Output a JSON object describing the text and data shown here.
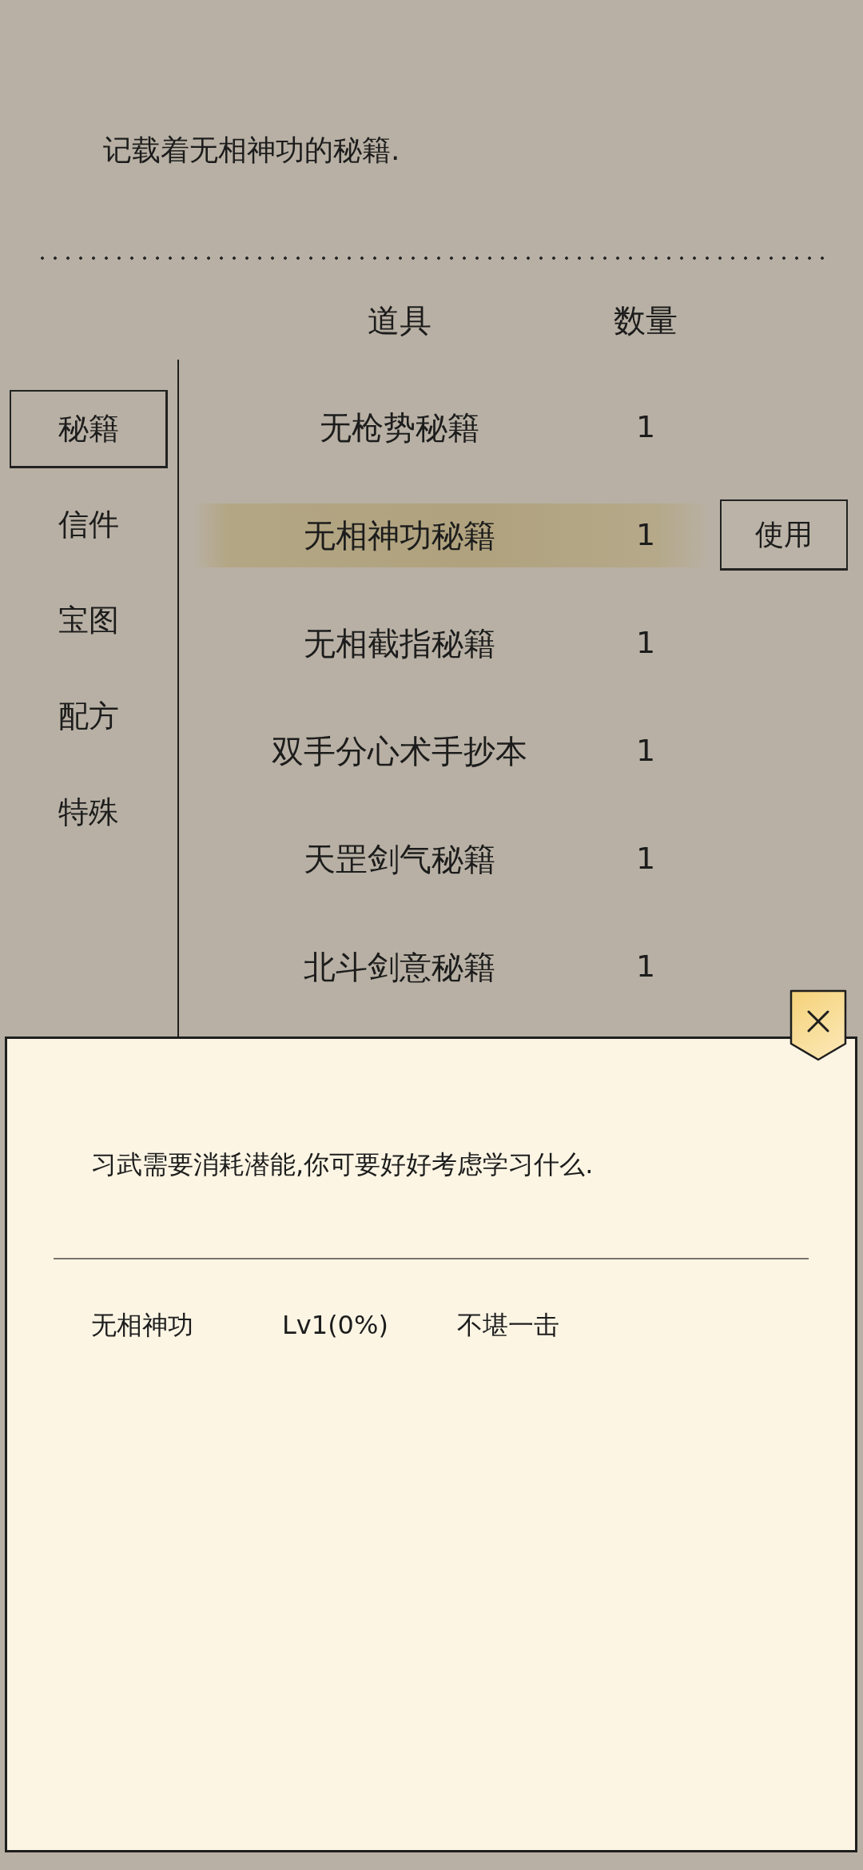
{
  "description": "记载着无相神功的秘籍.",
  "sidebar": {
    "tabs": [
      {
        "label": "秘籍",
        "selected": true
      },
      {
        "label": "信件",
        "selected": false
      },
      {
        "label": "宝图",
        "selected": false
      },
      {
        "label": "配方",
        "selected": false
      },
      {
        "label": "特殊",
        "selected": false
      }
    ]
  },
  "table": {
    "columns": [
      "道具",
      "数量"
    ],
    "rows": [
      {
        "name": "无枪势秘籍",
        "count": "1",
        "selected": false
      },
      {
        "name": "无相神功秘籍",
        "count": "1",
        "selected": true,
        "button": "使用"
      },
      {
        "name": "无相截指秘籍",
        "count": "1",
        "selected": false
      },
      {
        "name": "双手分心术手抄本",
        "count": "1",
        "selected": false
      },
      {
        "name": "天罡剑气秘籍",
        "count": "1",
        "selected": false
      },
      {
        "name": "北斗剑意秘籍",
        "count": "1",
        "selected": false
      }
    ]
  },
  "dialog": {
    "message": "习武需要消耗潜能,你可要好好考虑学习什么.",
    "skills": [
      {
        "name": "无相神功",
        "lv": "Lv1(0%)",
        "rating": "不堪一击"
      }
    ]
  }
}
